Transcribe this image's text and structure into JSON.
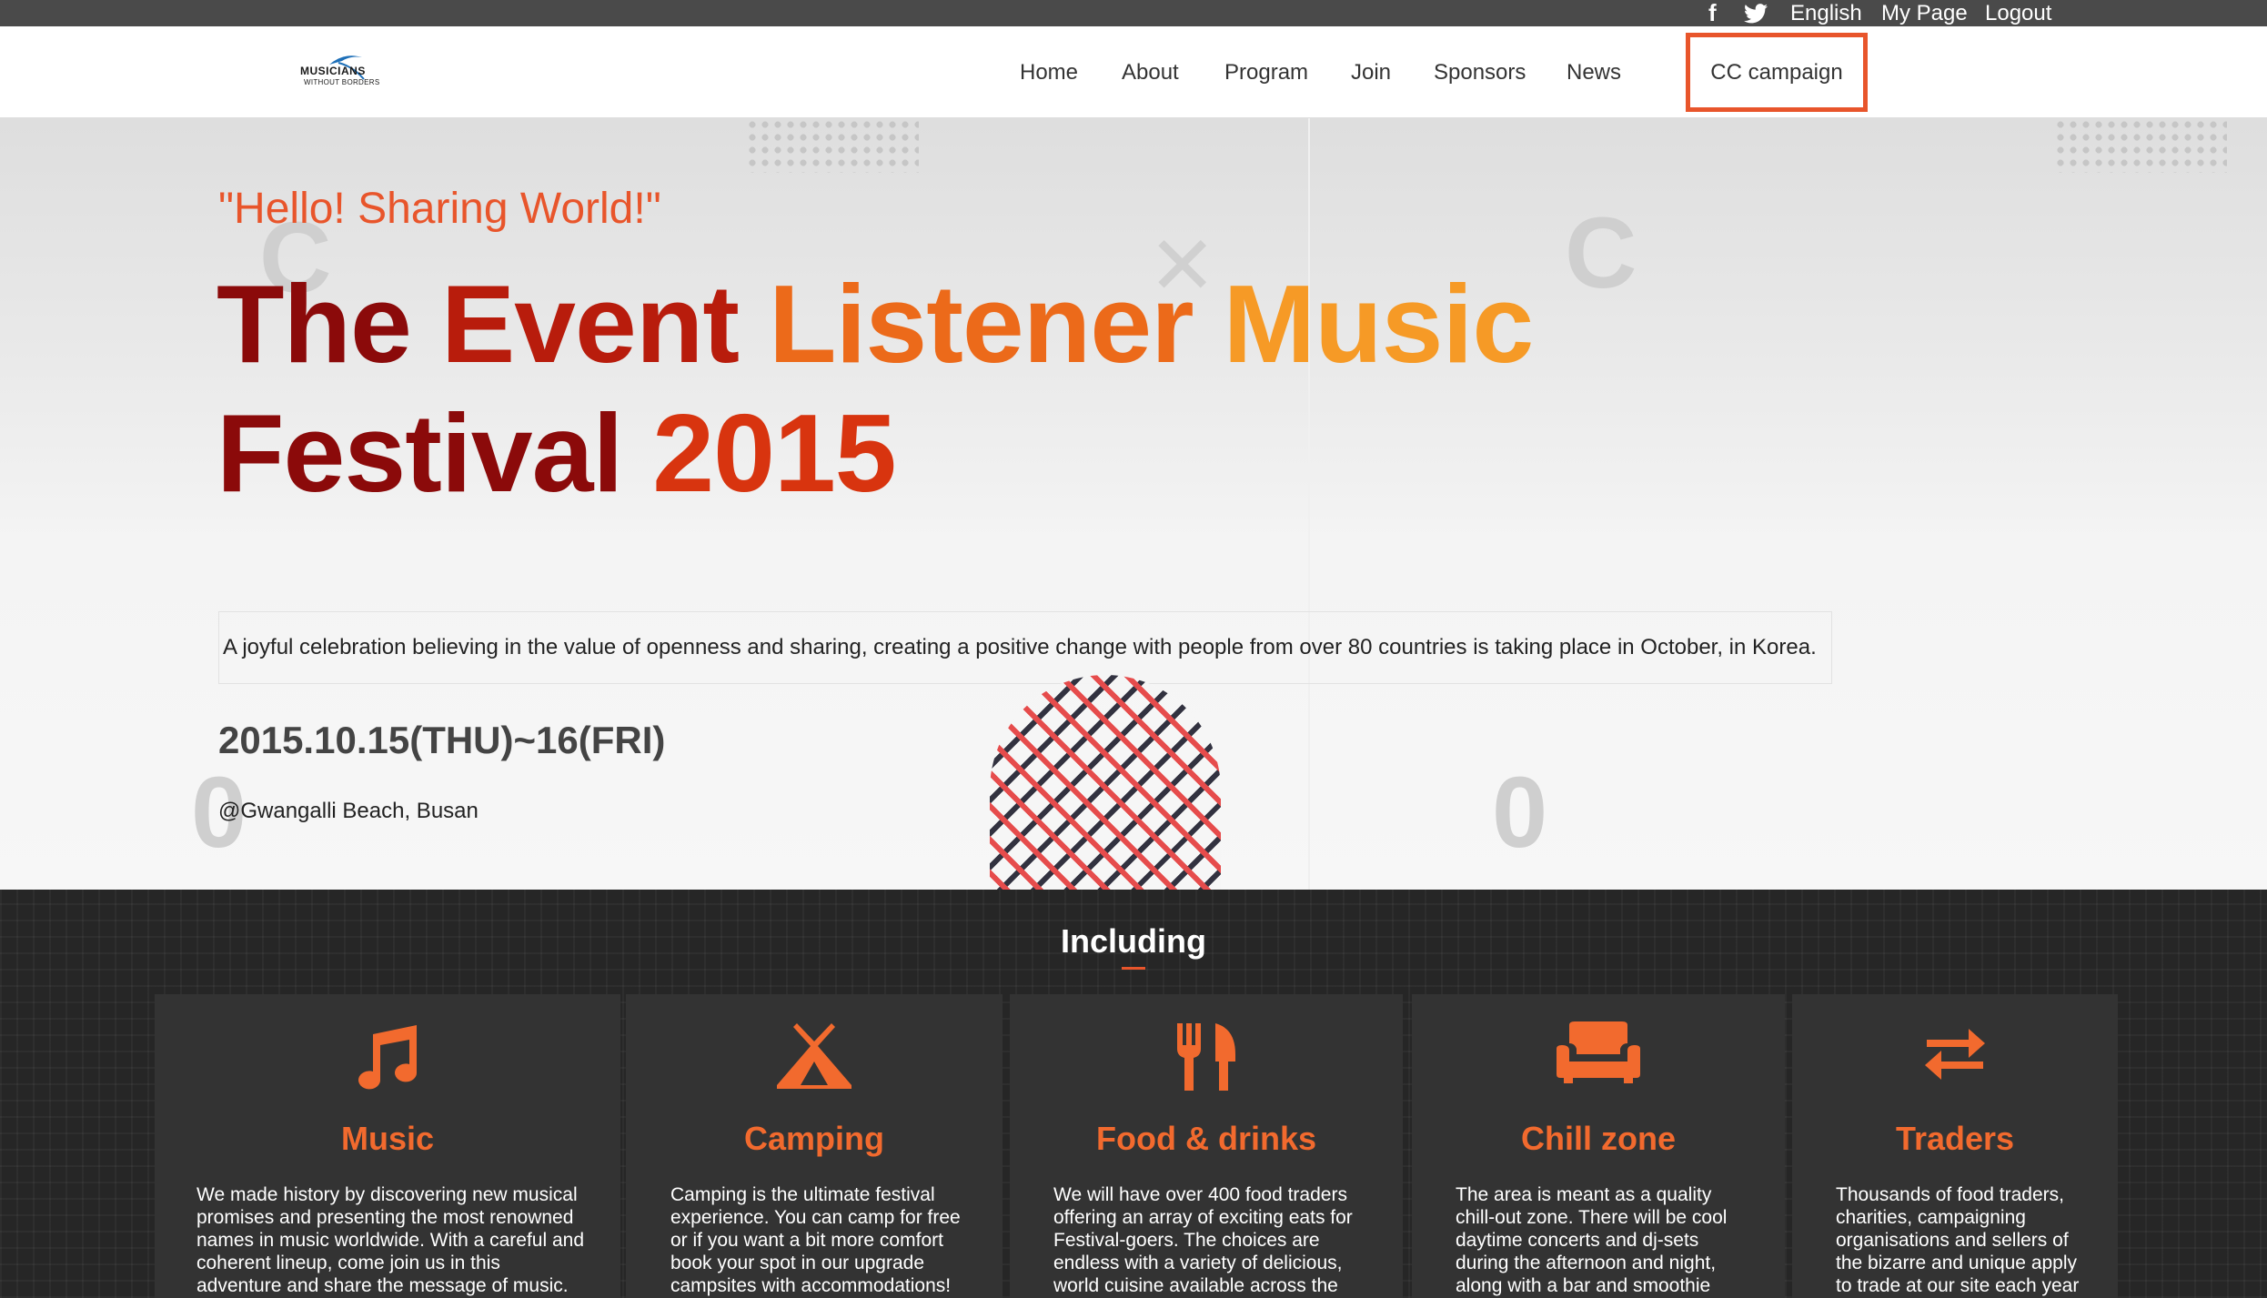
{
  "topbar": {
    "facebook_icon": "f",
    "twitter_icon": "twitter-bird",
    "language": "English",
    "my_page": "My Page",
    "logout": "Logout"
  },
  "header": {
    "logo_line1": "MUSICIANS",
    "logo_line2": "WITHOUT BORDERS",
    "nav": [
      "Home",
      "About",
      "Program",
      "Join",
      "Sponsors",
      "News"
    ],
    "cc_campaign": "CC campaign",
    "cc_highlight_color": "#e8552b"
  },
  "hero": {
    "subtitle": "\"Hello! Sharing World!\"",
    "title_words": [
      "The",
      "Event",
      "Listener",
      "Music",
      "Festival",
      "2015"
    ],
    "description": "A joyful celebration believing in the value of openness and sharing, creating a positive change with people from over 80 countries is taking place in October, in Korea.",
    "dates": "2015.10.15(THU)~16(FRI)",
    "location": "@Gwangalli Beach, Busan"
  },
  "including": {
    "title": "Including",
    "accent_color": "#f26a2e",
    "cards": [
      {
        "icon": "music-note-icon",
        "name": "Music",
        "lines": [
          "We made history by discovering new musical",
          "promises and presenting the most renowned",
          "names in music worldwide. With a careful and",
          "coherent lineup, come join us in this",
          "adventure and share the message of music."
        ]
      },
      {
        "icon": "tent-icon",
        "name": "Camping",
        "lines": [
          "Camping is the ultimate festival",
          "experience. You can camp for free",
          "or if you want a bit more comfort",
          "book your spot in our upgrade",
          "campsites with accommodations!"
        ]
      },
      {
        "icon": "fork-knife-icon",
        "name": "Food & drinks",
        "lines": [
          "We will have over 400 food traders",
          "offering an array of exciting eats for",
          "Festival-goers. The choices are",
          "endless with a variety of delicious,",
          "world cuisine available across the"
        ]
      },
      {
        "icon": "sofa-icon",
        "name": "Chill zone",
        "lines": [
          "The area is meant as a quality",
          "chill-out zone. There will be cool",
          "daytime concerts and dj-sets",
          "during the afternoon and night,",
          "along with a bar and smoothie"
        ]
      },
      {
        "icon": "exchange-arrows-icon",
        "name": "Traders",
        "lines": [
          "Thousands of food traders,",
          "charities, campaigning",
          "organisations and sellers of",
          "the bizarre and unique apply",
          "to trade at our site each year"
        ]
      }
    ]
  }
}
